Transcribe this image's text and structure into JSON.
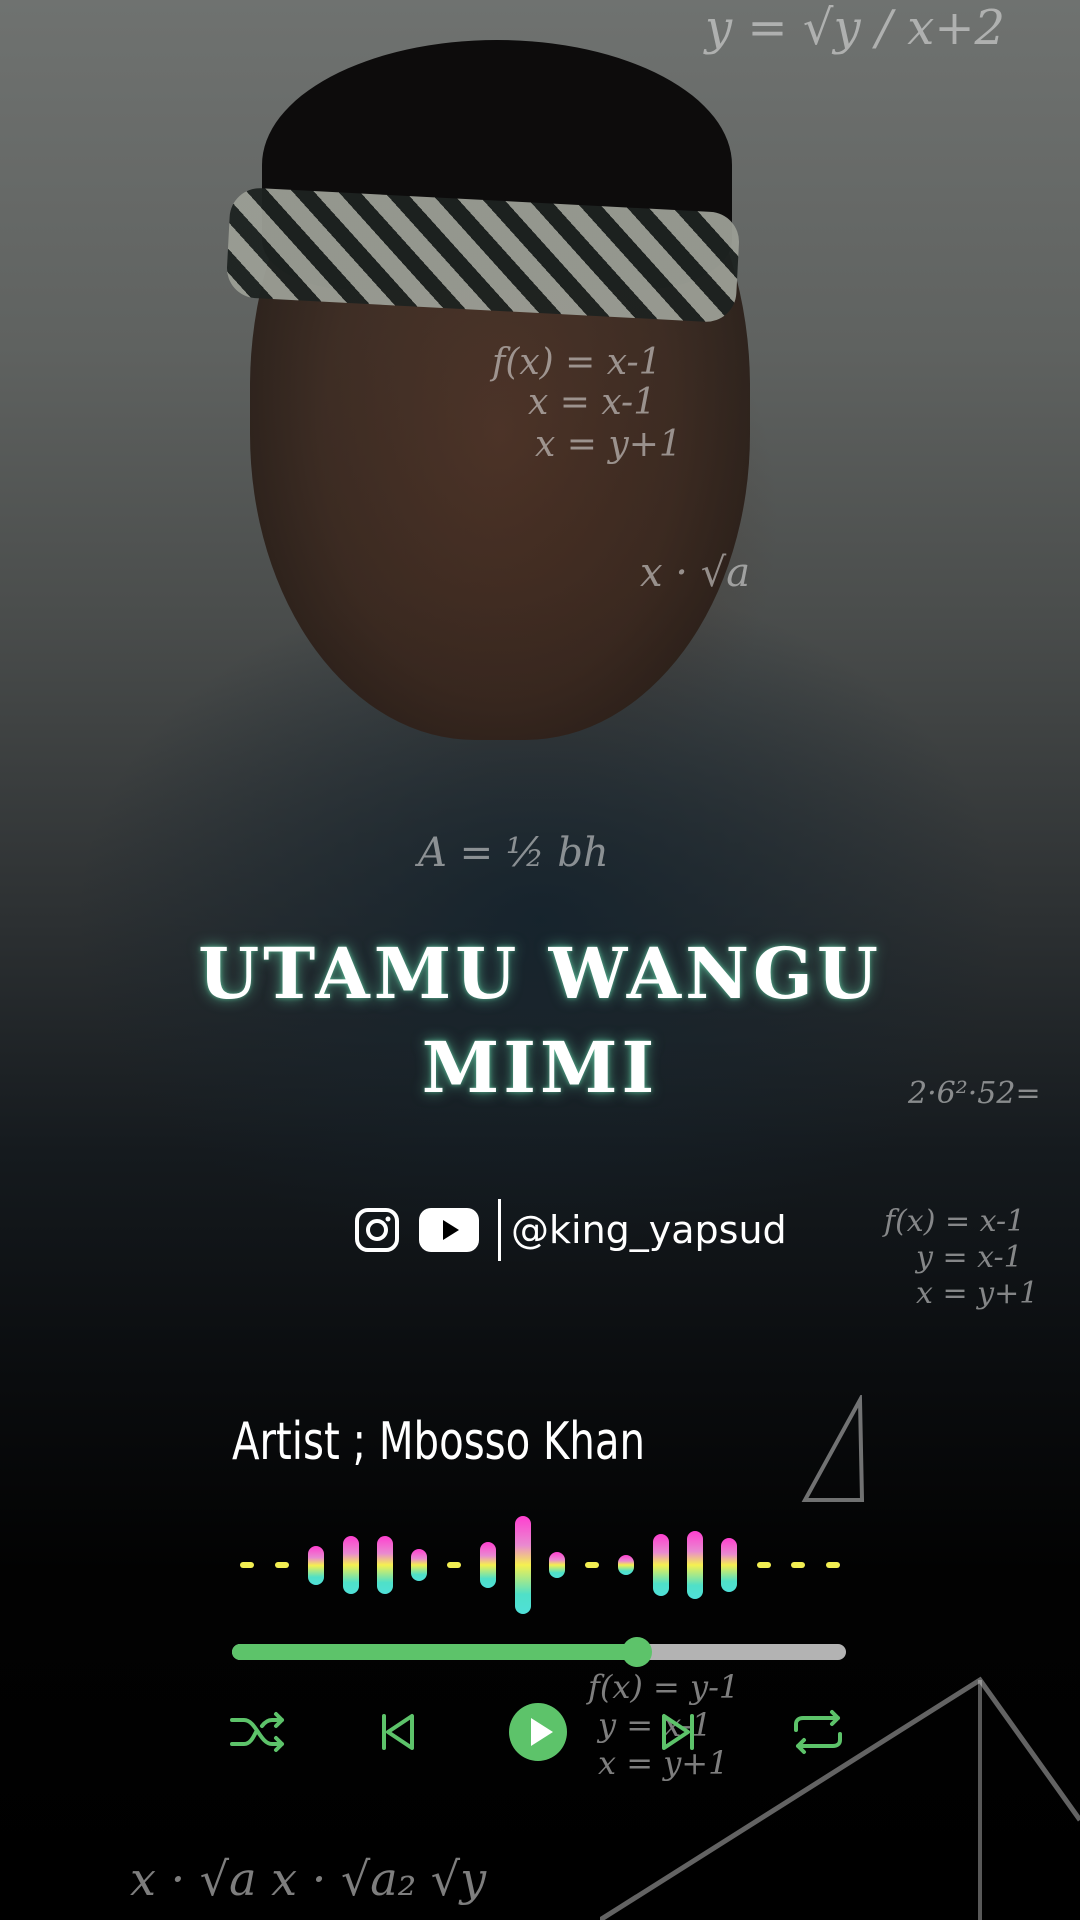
{
  "song": {
    "title_line1": "UTAMU WANGU",
    "title_line2": "MIMI",
    "artist_text": "Artist ; Mbosso Khan"
  },
  "social": {
    "icons": [
      "instagram-icon",
      "youtube-icon"
    ],
    "handle": "@king_yapsud"
  },
  "background": {
    "math_text": {
      "formula_top": "y = √y / x+2",
      "fx1": "f(x) = x-1",
      "fx2": "x = x-1",
      "fx3": "x = y+1",
      "sqrt": "x · √a",
      "area": "A = ½ bh",
      "right_fx1": "f(x) = x-1",
      "right_fx2": "y = x-1",
      "right_fx3": "x = y+1",
      "right_num": "2·6²·52=",
      "bottom_fx1": "f(x) = y-1",
      "bottom_fx2": "y = x-1",
      "bottom_fx3": "x = y+1",
      "bottom_sqrt": "x · √a x · √a₂ √y"
    }
  },
  "player": {
    "progress_fraction": 0.66,
    "equalizer_levels": [
      0.05,
      0.08,
      0.3,
      0.45,
      0.45,
      0.25,
      0.08,
      0.35,
      0.75,
      0.2,
      0.1,
      0.15,
      0.48,
      0.52,
      0.42,
      0.08,
      0.05,
      0.05
    ],
    "colors": {
      "accent": "#5dc36a",
      "track": "#b3b3b3",
      "eq_top": "#ff3fd0",
      "eq_mid": "#f5f050",
      "eq_bottom": "#4fe0d8"
    },
    "controls": [
      "shuffle-icon",
      "previous-icon",
      "play-icon",
      "next-icon",
      "repeat-icon"
    ]
  }
}
